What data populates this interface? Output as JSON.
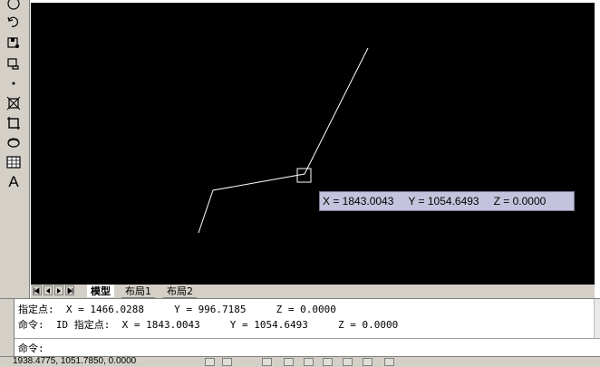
{
  "toolbar": {
    "tools": [
      "rotate-icon",
      "undo-icon",
      "save-icon",
      "open-icon",
      "point-icon",
      "trim-icon",
      "extend-icon",
      "region-icon",
      "table-icon",
      "text-icon"
    ],
    "text_tool_label": "A"
  },
  "canvas": {
    "background": "#000000",
    "line_color": "#ffffff",
    "tooltip": {
      "x": "X = 1843.0043",
      "y": "Y = 1054.6493",
      "z": "Z = 0.0000"
    }
  },
  "tabs": {
    "items": [
      "模型",
      "布局1",
      "布局2"
    ],
    "active": "模型"
  },
  "command": {
    "history": [
      "指定点:  X = 1466.0288     Y = 996.7185     Z = 0.0000",
      "命令:  ID 指定点:  X = 1843.0043     Y = 1054.6493     Z = 0.0000"
    ],
    "prompt": "命令:"
  },
  "status": {
    "coordinates": "1938.4775, 1051.7850, 0.0000"
  }
}
